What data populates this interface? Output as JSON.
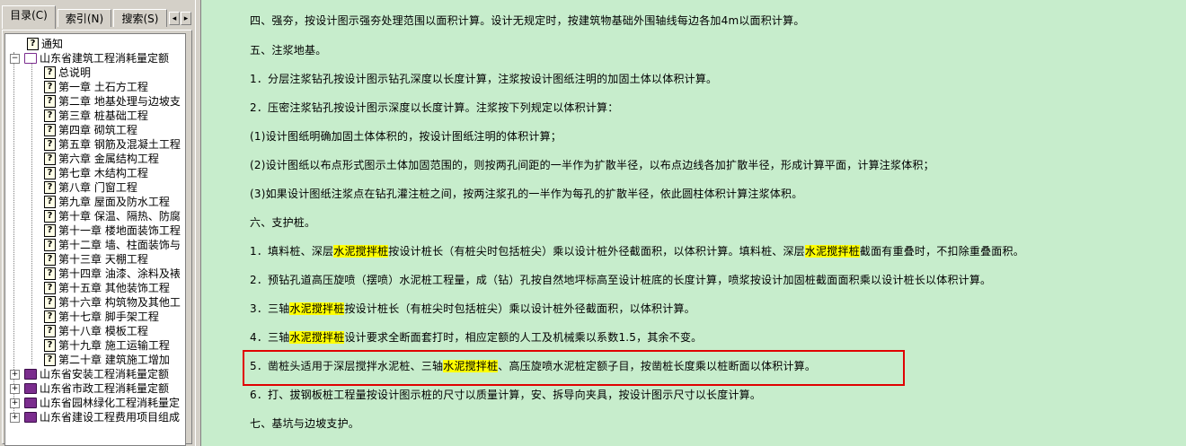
{
  "tabs": {
    "contents": "目录(C)",
    "index": "索引(N)",
    "search": "搜索(S)",
    "prev_arrow": "◂",
    "next_arrow": "▸"
  },
  "tree": {
    "notice": "通知",
    "root": "山东省建筑工程消耗量定额",
    "chapters": [
      "总说明",
      "第一章 土石方工程",
      "第二章 地基处理与边坡支",
      "第三章 桩基础工程",
      "第四章 砌筑工程",
      "第五章 钢筋及混凝土工程",
      "第六章 金属结构工程",
      "第七章 木结构工程",
      "第八章 门窗工程",
      "第九章 屋面及防水工程",
      "第十章 保温、隔热、防腐",
      "第十一章 楼地面装饰工程",
      "第十二章 墙、柱面装饰与",
      "第十三章 天棚工程",
      "第十四章 油漆、涂料及裱",
      "第十五章 其他装饰工程",
      "第十六章 构筑物及其他工",
      "第十七章 脚手架工程",
      "第十八章 模板工程",
      "第十九章 施工运输工程",
      "第二十章 建筑施工增加"
    ],
    "books": [
      "山东省安装工程消耗量定额",
      "山东省市政工程消耗量定额",
      "山东省园林绿化工程消耗量定",
      "山东省建设工程费用项目组成"
    ],
    "expand_symbol": "+",
    "collapse_symbol": "−",
    "help_icon_glyph": "?"
  },
  "content": {
    "p1": "四、强夯，按设计图示强夯处理范围以面积计算。设计无规定时，按建筑物基础外围轴线每边各加4m以面积计算。",
    "p2": "五、注浆地基。",
    "p3": "1．分层注浆钻孔按设计图示钻孔深度以长度计算，注浆按设计图纸注明的加固土体以体积计算。",
    "p4": "2．压密注浆钻孔按设计图示深度以长度计算。注浆按下列规定以体积计算：",
    "p5": "(1)设计图纸明确加固土体体积的，按设计图纸注明的体积计算；",
    "p6": "(2)设计图纸以布点形式图示土体加固范围的，则按两孔间距的一半作为扩散半径，以布点边线各加扩散半径，形成计算平面，计算注浆体积；",
    "p7": "(3)如果设计图纸注浆点在钻孔灌注桩之间，按两注浆孔的一半作为每孔的扩散半径，依此圆柱体积计算注浆体积。",
    "p8": "六、支护桩。",
    "p9": {
      "a": "1．填料桩、深层",
      "hl1": "水泥搅拌桩",
      "b": "按设计桩长（有桩尖时包括桩尖）乘以设计桩外径截面积，以体积计算。填料桩、深层",
      "hl2": "水泥搅拌桩",
      "c": "截面有重叠时，不扣除重叠面积。"
    },
    "p10": "2．预钻孔道高压旋喷（摆喷）水泥桩工程量，成（钻）孔按自然地坪标高至设计桩底的长度计算，喷浆按设计加固桩截面面积乘以设计桩长以体积计算。",
    "p11": {
      "a": "3．三轴",
      "hl": "水泥搅拌桩",
      "b": "按设计桩长（有桩尖时包括桩尖）乘以设计桩外径截面积，以体积计算。"
    },
    "p12": {
      "a": "4．三轴",
      "hl": "水泥搅拌桩",
      "b": "设计要求全断面套打时，相应定额的人工及机械乘以系数1.5，其余不变。"
    },
    "p13": {
      "a": "5．凿桩头适用于深层搅拌水泥桩、三轴",
      "hl": "水泥搅拌桩",
      "b": "、高压旋喷水泥桩定额子目，按凿桩长度乘以桩断面以体积计算。"
    },
    "p14": "6．打、拔钢板桩工程量按设计图示桩的尺寸以质量计算，安、拆导向夹具，按设计图示尺寸以长度计算。",
    "p15": "七、基坑与边坡支护。"
  },
  "colors": {
    "content_bg": "#c7edcc",
    "highlight": "#ffff00",
    "annotation_box": "#e00000",
    "book_icon": "#7b2d8e"
  }
}
